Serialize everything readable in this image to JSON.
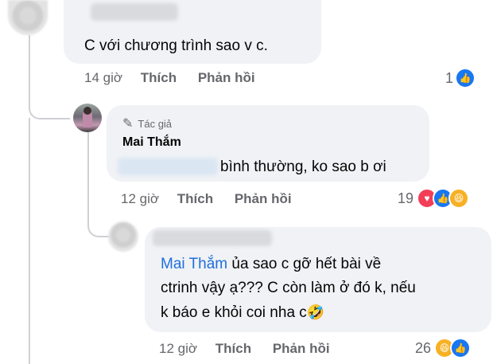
{
  "comments": [
    {
      "text": "C với chương trình sao v c.",
      "time": "14 giờ",
      "like_label": "Thích",
      "reply_label": "Phản hồi",
      "reaction_count": "1"
    },
    {
      "author_badge": "Tác giả",
      "author_name": "Mai Thắm",
      "text": "bình thường, ko sao b ơi",
      "time": "12 giờ",
      "like_label": "Thích",
      "reply_label": "Phản hồi",
      "reaction_count": "19"
    },
    {
      "mention": "Mai Thắm",
      "text_line1": " ủa sao c gỡ hết bài về",
      "text_line2": "ctrinh vậy ạ??? C còn làm ở đó k, nếu",
      "text_line3": "k báo e khỏi coi nha c",
      "emoji": "🤣",
      "time": "12 giờ",
      "like_label": "Thích",
      "reply_label": "Phản hồi",
      "reaction_count": "26"
    }
  ],
  "icons": {
    "like": "like-icon",
    "love": "love-icon",
    "haha": "haha-icon",
    "pencil": "pencil-icon"
  },
  "colors": {
    "bubble": "#f0f2f5",
    "meta_gray": "#65676b",
    "like_blue": "#1877f2",
    "love_red": "#f33e58",
    "haha_yellow": "#f7b125",
    "mention_blue": "#216fdb"
  }
}
